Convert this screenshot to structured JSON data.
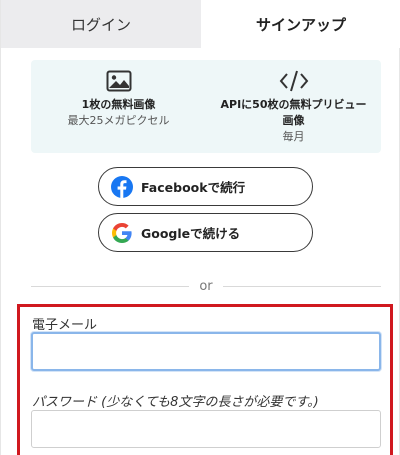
{
  "tabs": [
    {
      "label": "ログイン",
      "active": false
    },
    {
      "label": "サインアップ",
      "active": true
    }
  ],
  "features": [
    {
      "icon": "image-icon",
      "title": "1枚の無料画像",
      "subtitle": "最大25メガピクセル"
    },
    {
      "icon": "code-icon",
      "title_line1": "APIに50枚の無料プリビュー",
      "title_line2": "画像",
      "subtitle": "毎月"
    }
  ],
  "social": {
    "facebook_label": "Facebookで続行",
    "google_label": "Googleで続ける"
  },
  "divider_text": "or",
  "form": {
    "email_label": "電子メール",
    "email_value": "",
    "password_label": "パスワード (少なくても8文字の長さが必要です。)",
    "password_value": ""
  },
  "colors": {
    "highlight": "#d0181f",
    "feature_bg": "#eef7f8",
    "facebook": "#1877f2"
  }
}
